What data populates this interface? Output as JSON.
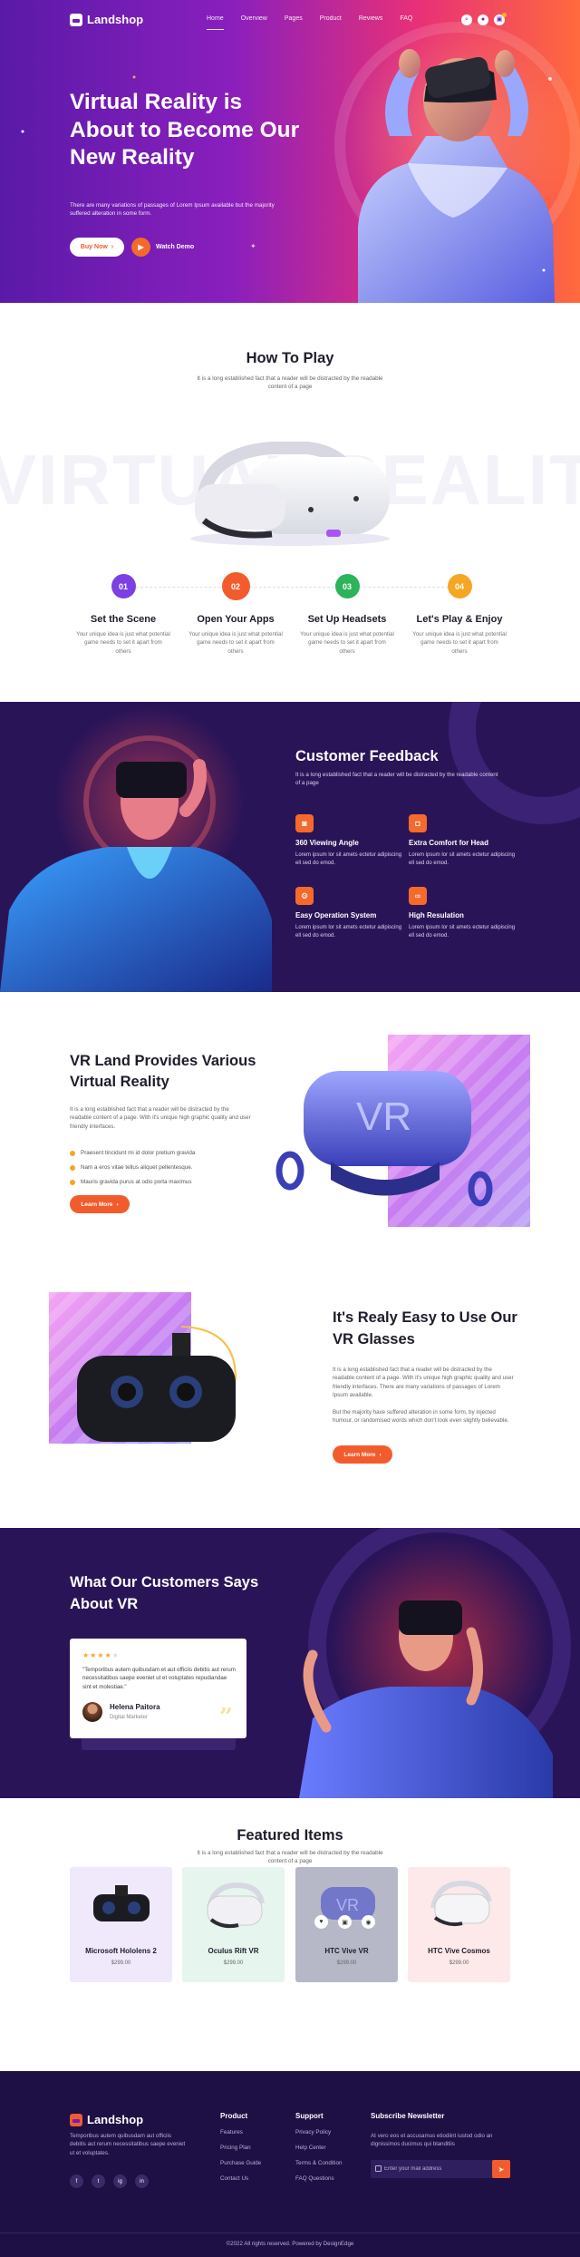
{
  "brand": {
    "name": "Landshop",
    "accent": "#f25c2d",
    "purple": "#2a1458"
  },
  "nav": {
    "items": [
      {
        "label": "Home",
        "active": true
      },
      {
        "label": "Overview"
      },
      {
        "label": "Pages"
      },
      {
        "label": "Product"
      },
      {
        "label": "Reviews"
      },
      {
        "label": "FAQ"
      }
    ],
    "icons": [
      "search-icon",
      "user-icon",
      "cart-icon"
    ]
  },
  "hero": {
    "title": "Virtual Reality is About to Become Our New Reality",
    "desc": "There are many variations of passages of Lorem Ipsum available but the majority suffered alteration in some form.",
    "buy_label": "Buy Now",
    "watch_label": "Watch Demo"
  },
  "how": {
    "title": "How To Play",
    "sub": "It is a long established fact that a reader will be distracted by the readable content of a page",
    "bg_word": "VIRTUAL REALITY",
    "steps": [
      {
        "num": "01",
        "title": "Set the Scene",
        "desc": "Your unique idea is just what potential game needs to set it apart from others",
        "color": "#7b3fe4"
      },
      {
        "num": "02",
        "title": "Open Your Apps",
        "desc": "Your unique idea is just what potential game needs to set it apart from others",
        "color": "#f25c2d"
      },
      {
        "num": "03",
        "title": "Set Up Headsets",
        "desc": "Your unique idea is just what potential game needs to set it apart from others",
        "color": "#2db35a"
      },
      {
        "num": "04",
        "title": "Let's Play & Enjoy",
        "desc": "Your unique idea is just what potential game needs to set it apart from others",
        "color": "#f5a623"
      }
    ]
  },
  "feedback": {
    "title": "Customer Feedback",
    "sub": "It is a long established fact that a reader will be distracted by the readable content of a page",
    "features": [
      {
        "title": "360 Viewing Angle",
        "desc": "Lorem ipsum lor sit amets ectetur adipiscing ell sed do emod.",
        "icon": "vr-icon"
      },
      {
        "title": "Extra Comfort for Head",
        "desc": "Lorem ipsum lor sit amets ectetur adipiscing ell sed do emod.",
        "icon": "headset-icon"
      },
      {
        "title": "Easy Operation System",
        "desc": "Lorem ipsum lor sit amets ectetur adipiscing ell sed do emod.",
        "icon": "gear-icon"
      },
      {
        "title": "High Resulation",
        "desc": "Lorem ipsum lor sit amets ectetur adipiscing ell sed do emod.",
        "icon": "glasses-icon"
      }
    ]
  },
  "provides": {
    "title": "VR Land Provides Various Virtual Reality",
    "desc": "It is a long established fact that a reader will be distracted by the readable content of a page. With it's unique high graphic quality and user friendly interfaces.",
    "bullets": [
      "Praesent tincidunt mi id dolor pretium gravida",
      "Nam a eros vitae tellus aliquet pellentesque.",
      "Mauris gravida purus at odio porta maximus"
    ],
    "btn": "Learn More",
    "vr_text": "VR"
  },
  "easy": {
    "title": "It's Realy Easy to Use Our VR Glasses",
    "p1": "It is a long established fact that a reader will be distracted by the readable content of a page. With it's unique high graphic quality and user friendly interfaces. There are many variations of passages of Lorem Ipsum available.",
    "p2": "But the majority have suffered alteration in some form, by injected humour, or randomised words which don't look even slightly believable.",
    "btn": "Learn More"
  },
  "testimonial": {
    "title": "What Our Customers Says About VR",
    "rating": 4,
    "quote": "\"Temporibus autem quibusdam et aut officiis debitis aut rerum necessitatibus saepe eveniet ut et voluptates repudiandae sint et molestiae.\"",
    "name": "Helena Paitora",
    "role": "Digital Marketer"
  },
  "featured": {
    "title": "Featured Items",
    "sub": "It is a long established fact that a reader will be distracted by the readable content of a page",
    "items": [
      {
        "name": "Microsoft Hololens 2",
        "price": "$299.00",
        "bg": "#efe9fb"
      },
      {
        "name": "Oculus Rift VR",
        "price": "$299.00",
        "bg": "#e6f6ee"
      },
      {
        "name": "HTC Vive VR",
        "price": "$299.00",
        "bg": "#b6b8c8"
      },
      {
        "name": "HTC Vive Cosmos",
        "price": "$299.00",
        "bg": "#fde9ea"
      }
    ]
  },
  "footer": {
    "brand": "Landshop",
    "desc": "Temporibus autem quibusdam aut officiis debitis aut rerum necessitatibus saepe eveniet ut et voluptates.",
    "social": [
      "f",
      "t",
      "ig",
      "in"
    ],
    "product_title": "Product",
    "product_links": [
      "Features",
      "Pricing Plan",
      "Purchase Guide",
      "Contact Us"
    ],
    "support_title": "Support",
    "support_links": [
      "Privacy Policy",
      "Help Center",
      "Terms & Condition",
      "FAQ Questions"
    ],
    "newsletter_title": "Subscribe Newsletter",
    "newsletter_desc": "At vero eos et accusamus etiodiint iustod odio an dignissimos ducimus qui blanditiis",
    "email_placeholder": "Enter your mail address",
    "copyright": "©2022 All rights reserved. Powered by DesignEdge"
  }
}
